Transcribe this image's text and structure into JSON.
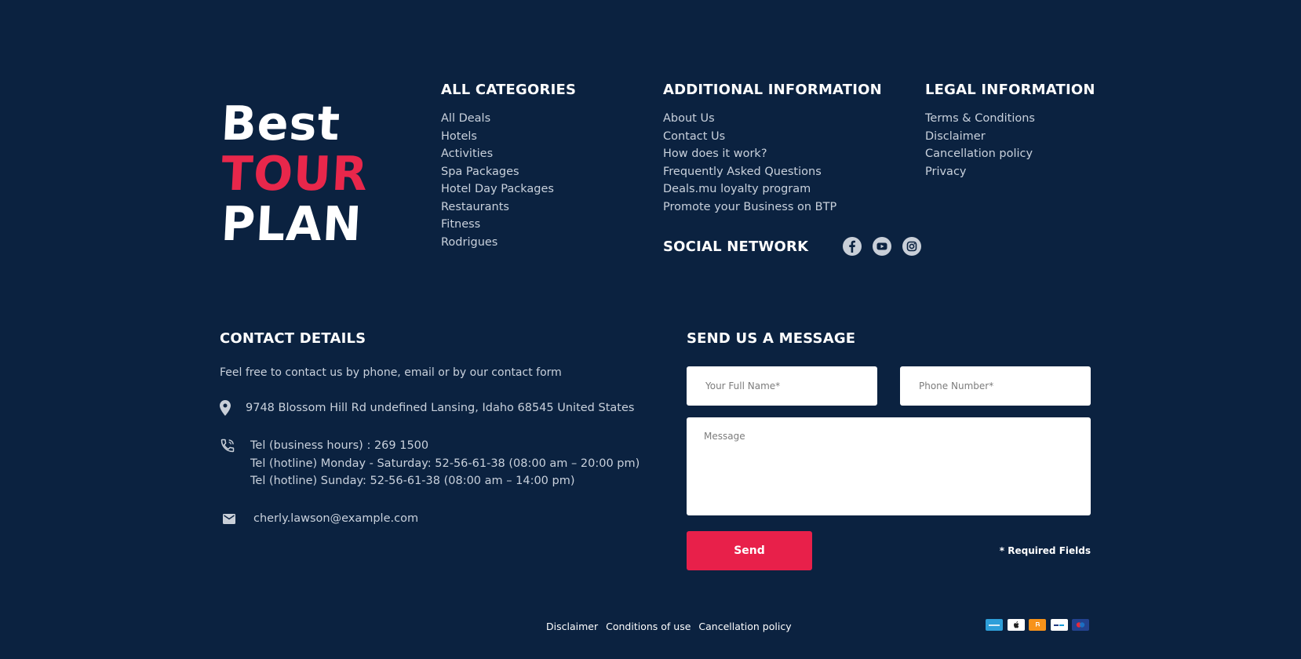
{
  "logo": {
    "line1": "Best",
    "line2": "TOUR",
    "line3": "PLAN"
  },
  "categories": {
    "title": "ALL CATEGORIES",
    "items": [
      "All Deals",
      "Hotels",
      "Activities",
      "Spa Packages",
      "Hotel Day Packages",
      "Restaurants",
      "Fitness",
      "Rodrigues"
    ]
  },
  "additional": {
    "title": "ADDITIONAL INFORMATION",
    "items": [
      "About Us",
      "Contact Us",
      "How does it work?",
      "Frequently Asked Questions",
      "Deals.mu loyalty program",
      "Promote your Business on BTP"
    ]
  },
  "legal": {
    "title": "LEGAL INFORMATION",
    "items": [
      "Terms & Conditions",
      "Disclaimer",
      "Cancellation policy",
      "Privacy"
    ]
  },
  "social": {
    "title": "SOCIAL NETWORK",
    "icons": [
      "facebook-icon",
      "youtube-icon",
      "instagram-icon"
    ]
  },
  "contact": {
    "title": "CONTACT DETAILS",
    "intro": "Feel free to contact us by phone, email or by our contact form",
    "address": "9748 Blossom Hill Rd undefined Lansing, Idaho 68545 United States",
    "phones": [
      "Tel (business hours) : 269 1500",
      "Tel (hotline) Monday - Saturday: 52-56-61-38 (08:00 am – 20:00 pm)",
      "Tel (hotline) Sunday: 52-56-61-38 (08:00 am – 14:00 pm)"
    ],
    "email": "cherly.lawson@example.com"
  },
  "form": {
    "title": "SEND US A MESSAGE",
    "name_placeholder": "Your Full Name*",
    "phone_placeholder": "Phone Number*",
    "message_placeholder": "Message",
    "send_label": "Send",
    "required_note": "* Required Fields"
  },
  "footer": {
    "links": [
      "Disclaimer",
      "Conditions of use",
      "Cancellation policy"
    ],
    "payment_icons": [
      "amex-icon",
      "apple-pay-icon",
      "bitcoin-icon",
      "paypal-icon",
      "mastercard-icon"
    ]
  },
  "colors": {
    "background": "#0b2240",
    "accent": "#e8274b",
    "text": "#c9d1dc"
  }
}
